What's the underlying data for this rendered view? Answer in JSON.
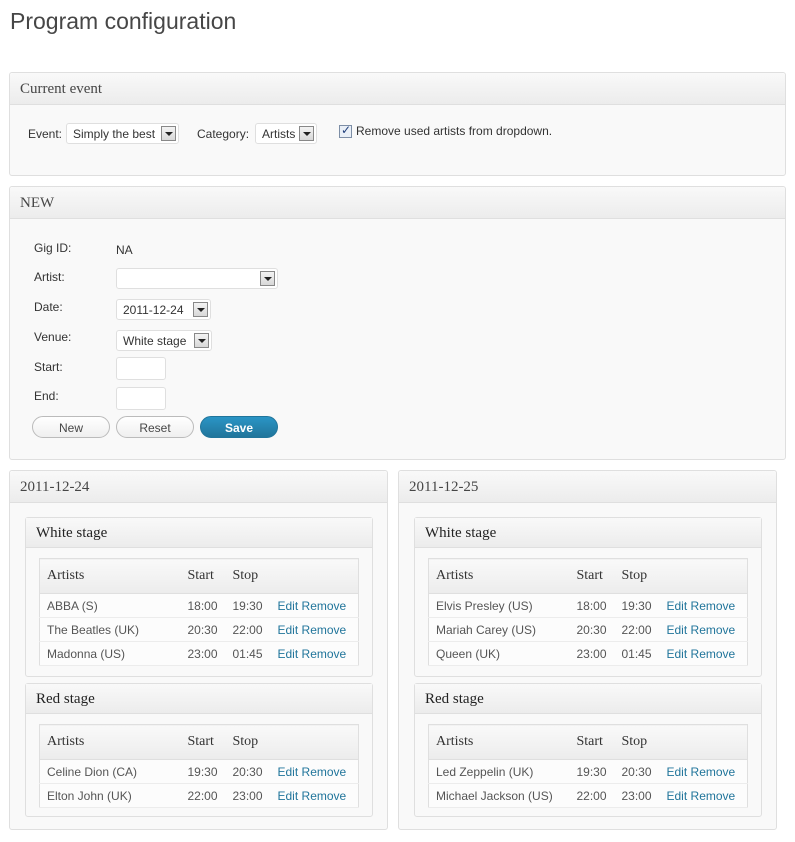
{
  "page": {
    "title": "Program configuration"
  },
  "current_event": {
    "heading": "Current event",
    "event_label": "Event:",
    "event_value": "Simply the best",
    "category_label": "Category:",
    "category_value": "Artists",
    "remove_used_label": "Remove used artists from dropdown.",
    "remove_used_checked": true
  },
  "new_gig": {
    "heading": "NEW",
    "gig_id_label": "Gig ID:",
    "gig_id_value": "NA",
    "artist_label": "Artist:",
    "artist_value": "",
    "date_label": "Date:",
    "date_value": "2011-12-24",
    "venue_label": "Venue:",
    "venue_value": "White stage",
    "start_label": "Start:",
    "end_label": "End:",
    "new_button": "New",
    "reset_button": "Reset",
    "save_button": "Save"
  },
  "columns": {
    "artists": "Artists",
    "start": "Start",
    "stop": "Stop",
    "edit": "Edit",
    "remove": "Remove"
  },
  "days": [
    {
      "date": "2011-12-24",
      "stages": [
        {
          "name": "White stage",
          "gigs": [
            {
              "artist": "ABBA (S)",
              "start": "18:00",
              "stop": "19:30"
            },
            {
              "artist": "The Beatles (UK)",
              "start": "20:30",
              "stop": "22:00"
            },
            {
              "artist": "Madonna (US)",
              "start": "23:00",
              "stop": "01:45"
            }
          ]
        },
        {
          "name": "Red stage",
          "gigs": [
            {
              "artist": "Celine Dion (CA)",
              "start": "19:30",
              "stop": "20:30"
            },
            {
              "artist": "Elton John (UK)",
              "start": "22:00",
              "stop": "23:00"
            }
          ]
        }
      ]
    },
    {
      "date": "2011-12-25",
      "stages": [
        {
          "name": "White stage",
          "gigs": [
            {
              "artist": "Elvis Presley (US)",
              "start": "18:00",
              "stop": "19:30"
            },
            {
              "artist": "Mariah Carey (US)",
              "start": "20:30",
              "stop": "22:00"
            },
            {
              "artist": "Queen (UK)",
              "start": "23:00",
              "stop": "01:45"
            }
          ]
        },
        {
          "name": "Red stage",
          "gigs": [
            {
              "artist": "Led Zeppelin (UK)",
              "start": "19:30",
              "stop": "20:30"
            },
            {
              "artist": "Michael Jackson (US)",
              "start": "22:00",
              "stop": "23:00"
            }
          ]
        }
      ]
    }
  ]
}
